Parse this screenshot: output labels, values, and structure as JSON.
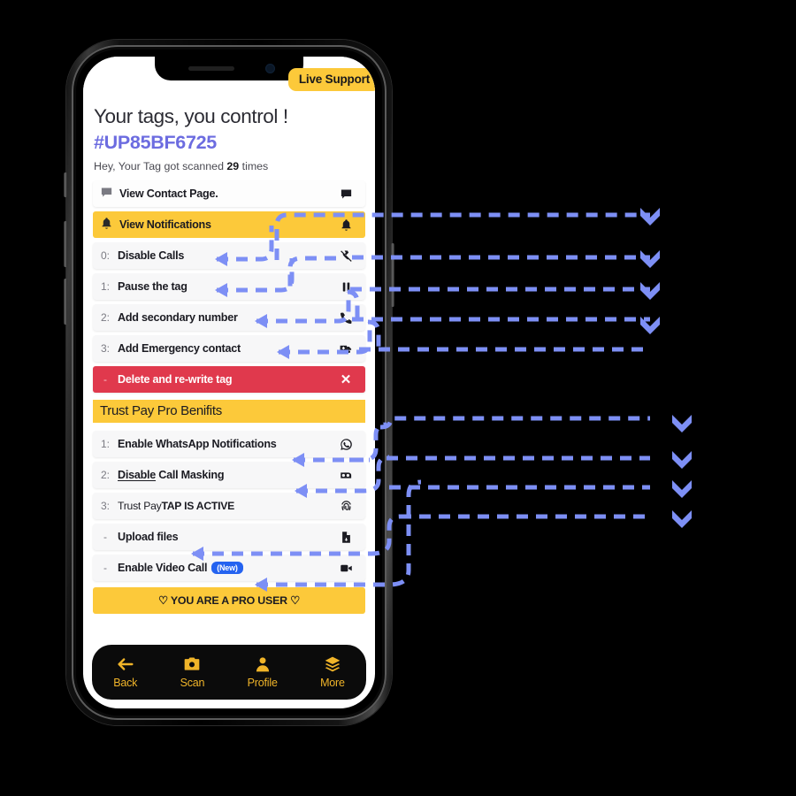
{
  "app": {
    "live_support_label": "Live Support",
    "page_title": "Your tags, you control !",
    "tag_id": "#UP85BF6725",
    "scan_prefix": "Hey, Your Tag got scanned ",
    "scan_count": "29",
    "scan_suffix": " times"
  },
  "main_rows": [
    {
      "num": "",
      "label": "View Contact Page.",
      "icon": "chat-bubble-icon",
      "style": "plain"
    },
    {
      "num": "",
      "label": "View Notifications",
      "icon": "bell-icon",
      "style": "active"
    },
    {
      "num": "0:",
      "label": "Disable Calls",
      "icon": "phone-off-icon",
      "style": "normal"
    },
    {
      "num": "1:",
      "label": "Pause the tag",
      "icon": "pause-icon",
      "style": "normal"
    },
    {
      "num": "2:",
      "label": "Add secondary number",
      "icon": "phone-icon",
      "style": "normal"
    },
    {
      "num": "3:",
      "label": "Add Emergency contact",
      "icon": "ambulance-icon",
      "style": "normal"
    },
    {
      "num": "-",
      "label": "Delete and re-write tag",
      "icon": "close-icon",
      "style": "danger"
    }
  ],
  "pro_section": {
    "title_light": "Trust Pay",
    "title_bold": " Pro Benifits",
    "rows": [
      {
        "num": "1:",
        "label": "Enable WhatsApp Notifications",
        "icon": "whatsapp-icon"
      },
      {
        "num": "2:",
        "label_underlined": "Disable",
        "label_rest": " Call Masking",
        "icon": "call-mask-icon"
      },
      {
        "num": "3:",
        "label_light": "Trust Pay",
        "label_bold": "TAP IS ACTIVE",
        "icon": "fingerprint-icon"
      },
      {
        "num": "-",
        "label": "Upload files",
        "icon": "file-upload-icon"
      },
      {
        "num": "-",
        "label": "Enable Video Call",
        "badge": "(New)",
        "icon": "video-camera-icon"
      }
    ]
  },
  "pro_banner": "♡ YOU ARE A PRO USER ♡",
  "bottom_nav": [
    {
      "label": "Back",
      "icon": "arrow-left-icon"
    },
    {
      "label": "Scan",
      "icon": "camera-icon"
    },
    {
      "label": "Profile",
      "icon": "person-icon"
    },
    {
      "label": "More",
      "icon": "layers-icon"
    }
  ],
  "colors": {
    "accent_yellow": "#fcc93a",
    "danger_red": "#e0394d",
    "tag_purple": "#6c6ce0",
    "badge_blue": "#2563f0",
    "nav_gold": "#f0b429",
    "connector_blue": "#7d8ff5"
  }
}
